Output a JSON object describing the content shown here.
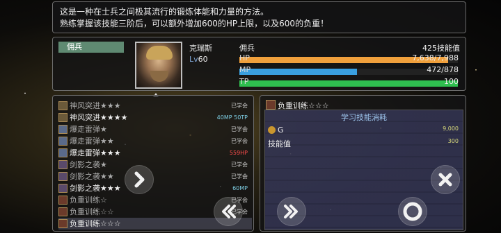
{
  "description": {
    "line1": "这是一种在士兵之间极其流行的锻炼体能和力量的方法。",
    "line2": "熟练掌握该技能三阶后，可以额外增加600的HP上限，以及600的负重！"
  },
  "character": {
    "job_tab": "佣兵",
    "name": "克瑞斯",
    "lv_prefix": "Lv",
    "level": "60",
    "class": "佣兵",
    "skill_points": "425",
    "skill_points_label": "技能值",
    "hp_label": "HP",
    "hp_value": "7,638/7,988",
    "hp_fraction": 0.956,
    "mp_label": "MP",
    "mp_value": "472/878",
    "mp_fraction": 0.538,
    "tp_label": "TP",
    "tp_value": "100",
    "tp_fraction": 1.0
  },
  "skills": [
    {
      "name": "神风突进★★★",
      "status": "已学会",
      "status_color": "#cccccc",
      "icon_color": "#6b5a3a",
      "dim": true
    },
    {
      "name": "神风突进★★★★",
      "status": "40MP 50TP",
      "status_color": "#7fd0e6",
      "icon_color": "#6b5a3a",
      "dim": false
    },
    {
      "name": "爆走雷弹★",
      "status": "已学会",
      "status_color": "#cccccc",
      "icon_color": "#5a6a8a",
      "dim": true
    },
    {
      "name": "爆走雷弹★★",
      "status": "已学会",
      "status_color": "#cccccc",
      "icon_color": "#5a6a8a",
      "dim": true
    },
    {
      "name": "爆走雷弹★★★",
      "status": "559HP",
      "status_color": "#ff4d4d",
      "icon_color": "#5a6a8a",
      "dim": false
    },
    {
      "name": "剑影之袭★",
      "status": "已学会",
      "status_color": "#cccccc",
      "icon_color": "#5a4a6a",
      "dim": true
    },
    {
      "name": "剑影之袭★★",
      "status": "已学会",
      "status_color": "#cccccc",
      "icon_color": "#5a4a6a",
      "dim": true
    },
    {
      "name": "剑影之袭★★★",
      "status": "60MP",
      "status_color": "#7fd0e6",
      "icon_color": "#5a4a6a",
      "dim": false
    },
    {
      "name": "负重训练☆",
      "status": "已学会",
      "status_color": "#cccccc",
      "icon_color": "#6b3a2a",
      "dim": true
    },
    {
      "name": "负重训练☆☆",
      "status": "已学会",
      "status_color": "#cccccc",
      "icon_color": "#6b3a2a",
      "dim": true
    },
    {
      "name": "负重训练☆☆☆",
      "status": "",
      "status_color": "#cccccc",
      "icon_color": "#6b3a2a",
      "dim": false
    }
  ],
  "learn": {
    "skill_name": "负重训练☆☆☆",
    "header": "学习技能消耗",
    "gold_label": "G",
    "gold_value": "9,000",
    "sp_label": "技能值",
    "sp_value": "300"
  },
  "colors": {
    "hp": "#f0a03c",
    "mp": "#3aa0e0",
    "tp": "#2fbf4f",
    "tab_green": "#5f8a72"
  },
  "icons": [
    "chevron-right-icon",
    "double-chevron-left-icon",
    "double-chevron-right-icon",
    "ring-confirm-icon",
    "close-x-icon"
  ]
}
